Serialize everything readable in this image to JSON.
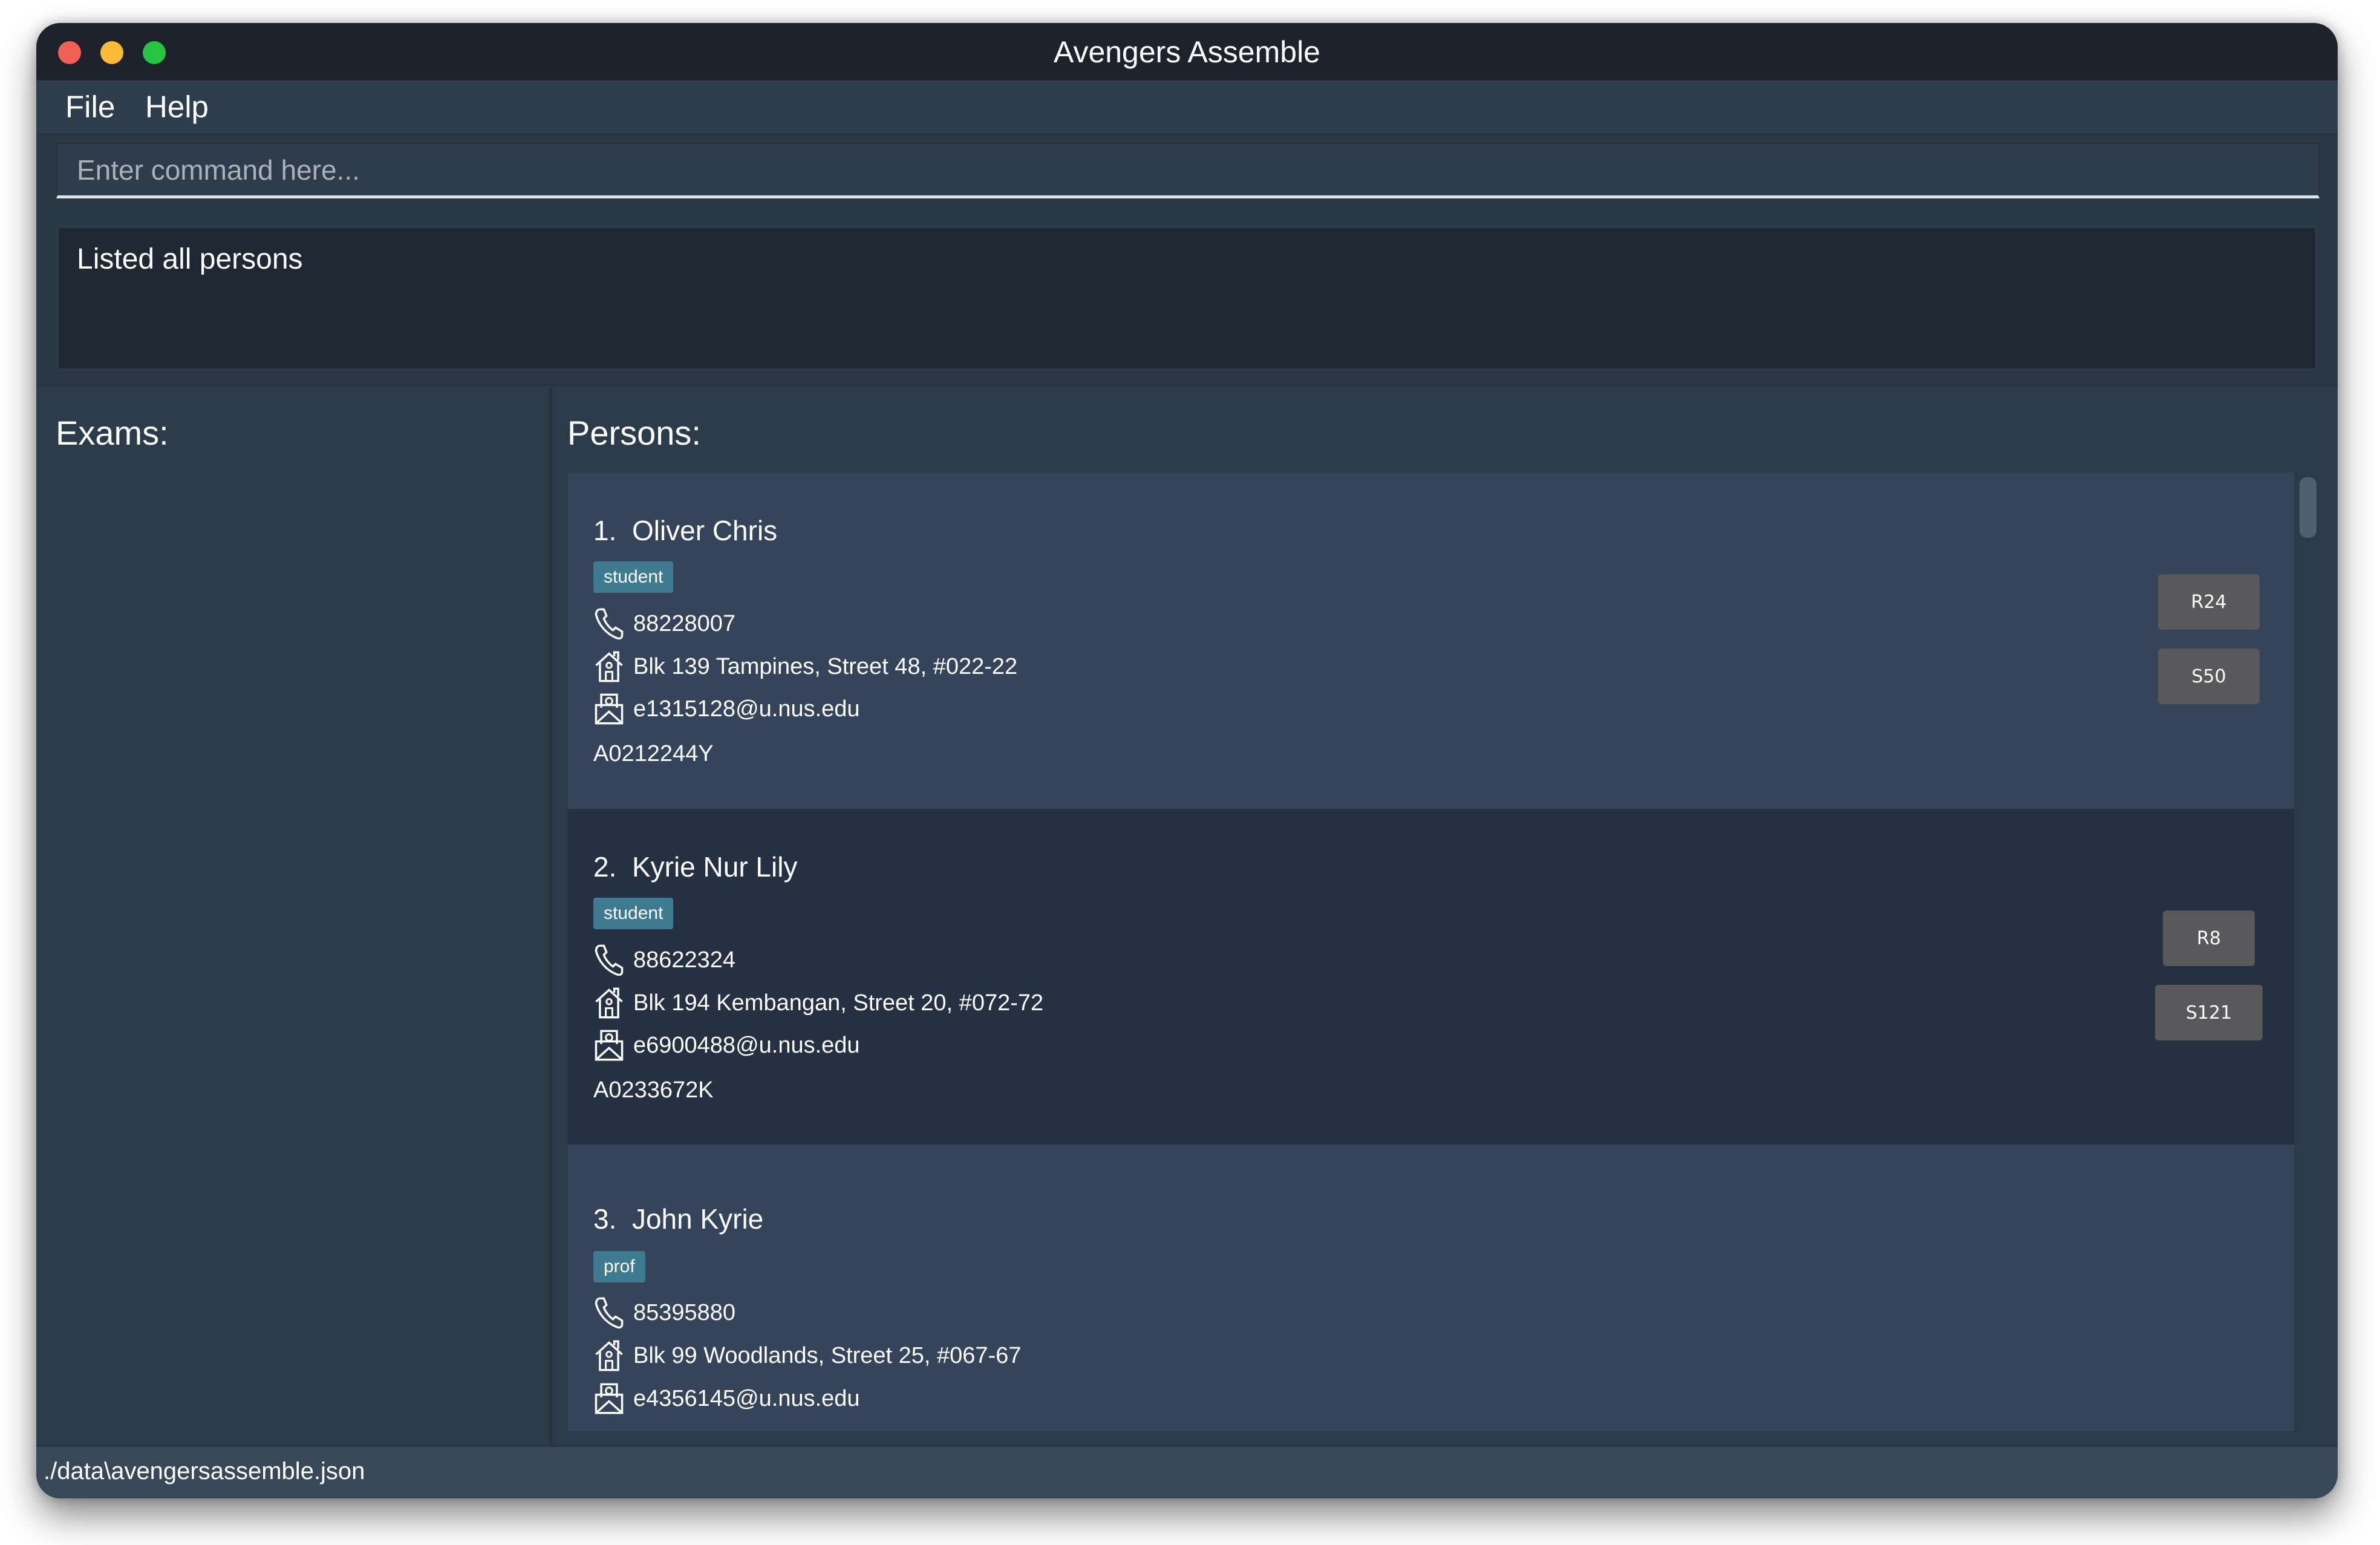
{
  "window": {
    "title": "Avengers Assemble",
    "traffic_lights": [
      "close",
      "minimize",
      "maximize"
    ]
  },
  "menu": {
    "items": [
      {
        "label": "File"
      },
      {
        "label": "Help"
      }
    ]
  },
  "command": {
    "value": "",
    "placeholder": "Enter command here..."
  },
  "result": {
    "message": "Listed all persons"
  },
  "exams_panel": {
    "title": "Exams:",
    "items": []
  },
  "persons_panel": {
    "title": "Persons:",
    "persons": [
      {
        "index": "1.",
        "name": "Oliver Chris",
        "tag": "student",
        "phone": "88228007",
        "address": "Blk 139 Tampines, Street 48, #022-22",
        "email": "e1315128@u.nus.edu",
        "matric": "A0212244Y",
        "lesson_buttons": [
          "R24",
          "S50"
        ]
      },
      {
        "index": "2.",
        "name": "Kyrie Nur Lily",
        "tag": "student",
        "phone": "88622324",
        "address": "Blk 194 Kembangan, Street 20, #072-72",
        "email": "e6900488@u.nus.edu",
        "matric": "A0233672K",
        "lesson_buttons": [
          "R8",
          "S121"
        ]
      },
      {
        "index": "3.",
        "name": "John Kyrie",
        "tag": "prof",
        "phone": "85395880",
        "address": "Blk 99 Woodlands, Street 25, #067-67",
        "email": "e4356145@u.nus.edu",
        "matric": "",
        "lesson_buttons": []
      }
    ]
  },
  "status_bar": {
    "file_path": "./data\\avengersassemble.json"
  },
  "colors": {
    "tag_bg": "#3e7b91",
    "card_odd": "#35445b",
    "card_even": "#253142",
    "lesson_button_bg": "#59595c",
    "titlebar": "#1d222c"
  }
}
